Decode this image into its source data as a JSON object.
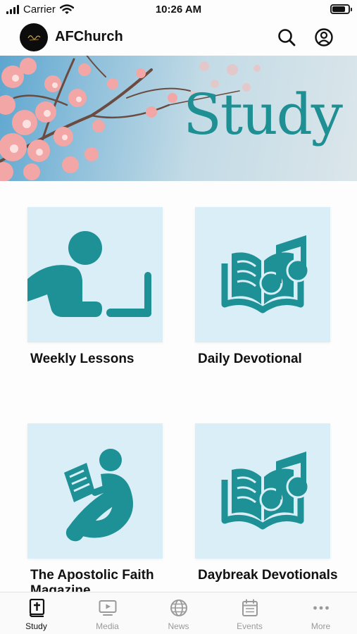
{
  "status_bar": {
    "carrier": "Carrier",
    "time": "10:26 AM",
    "battery_level": 0.9
  },
  "header": {
    "app_name": "AFChurch",
    "search_icon": "search-icon",
    "profile_icon": "profile-icon"
  },
  "banner": {
    "title": "Study"
  },
  "cards": [
    {
      "label": "Weekly Lessons",
      "icon": "student-laptop-icon"
    },
    {
      "label": "Daily Devotional",
      "icon": "book-music-icon"
    },
    {
      "label": "The Apostolic Faith Magazine",
      "icon": "person-reading-icon"
    },
    {
      "label": "Daybreak Devotionals",
      "icon": "book-music-icon"
    }
  ],
  "tabs": [
    {
      "label": "Study",
      "icon": "bible-icon",
      "active": true
    },
    {
      "label": "Media",
      "icon": "tv-play-icon",
      "active": false
    },
    {
      "label": "News",
      "icon": "globe-icon",
      "active": false
    },
    {
      "label": "Events",
      "icon": "calendar-icon",
      "active": false
    },
    {
      "label": "More",
      "icon": "more-dots-icon",
      "active": false
    }
  ],
  "colors": {
    "accent": "#1e9196",
    "tile_bg": "#d9eef7",
    "tab_inactive": "#9a9a9a"
  }
}
